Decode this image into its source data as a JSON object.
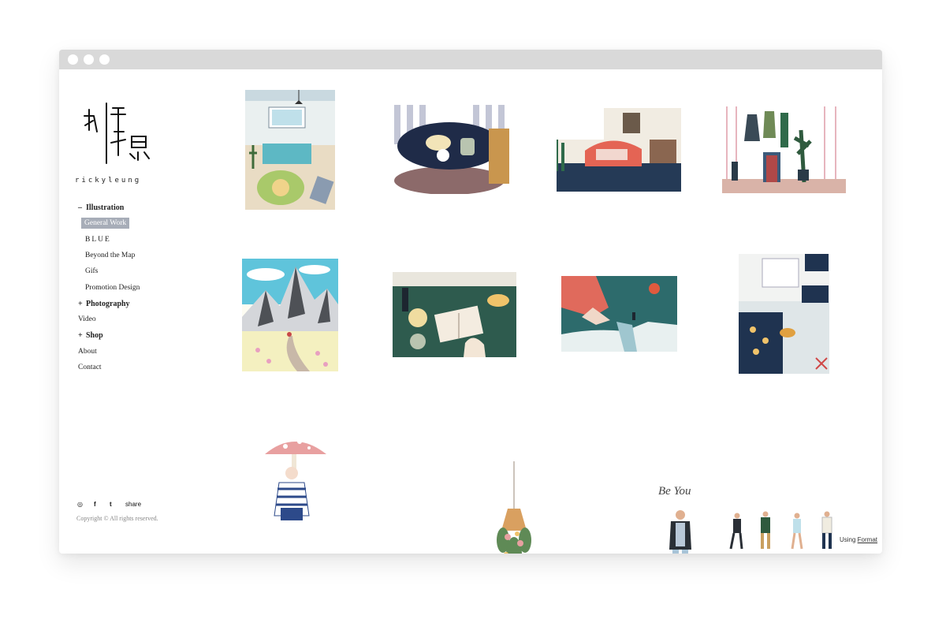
{
  "site": {
    "logo_caption": "rickyleung"
  },
  "nav": {
    "illustration": {
      "mark": "–",
      "label": "Illustration"
    },
    "illustration_sub": [
      "General Work",
      "BLUE",
      "Beyond the Map",
      "Gifs",
      "Promotion Design"
    ],
    "photography": {
      "mark": "+",
      "label": "Photography"
    },
    "video": "Video",
    "shop": {
      "mark": "+",
      "label": "Shop"
    },
    "about": "About",
    "contact": "Contact"
  },
  "footer": {
    "social": {
      "instagram": "◎",
      "facebook": "f",
      "tumblr": "t",
      "share": "share"
    },
    "copyright": "Copyright © All rights reserved.",
    "using_text": "Using",
    "using_link": "Format"
  },
  "gallery": {
    "signature_text": "Be You"
  },
  "colors": {
    "active_nav_bg": "#a7adb8",
    "window_bar": "#d9d9d9",
    "accent_navy": "#1f3350",
    "accent_green": "#2e5b4e",
    "accent_coral": "#e07060"
  },
  "icons": [
    "instagram-icon",
    "facebook-icon",
    "tumblr-icon",
    "window-dot-icon"
  ]
}
